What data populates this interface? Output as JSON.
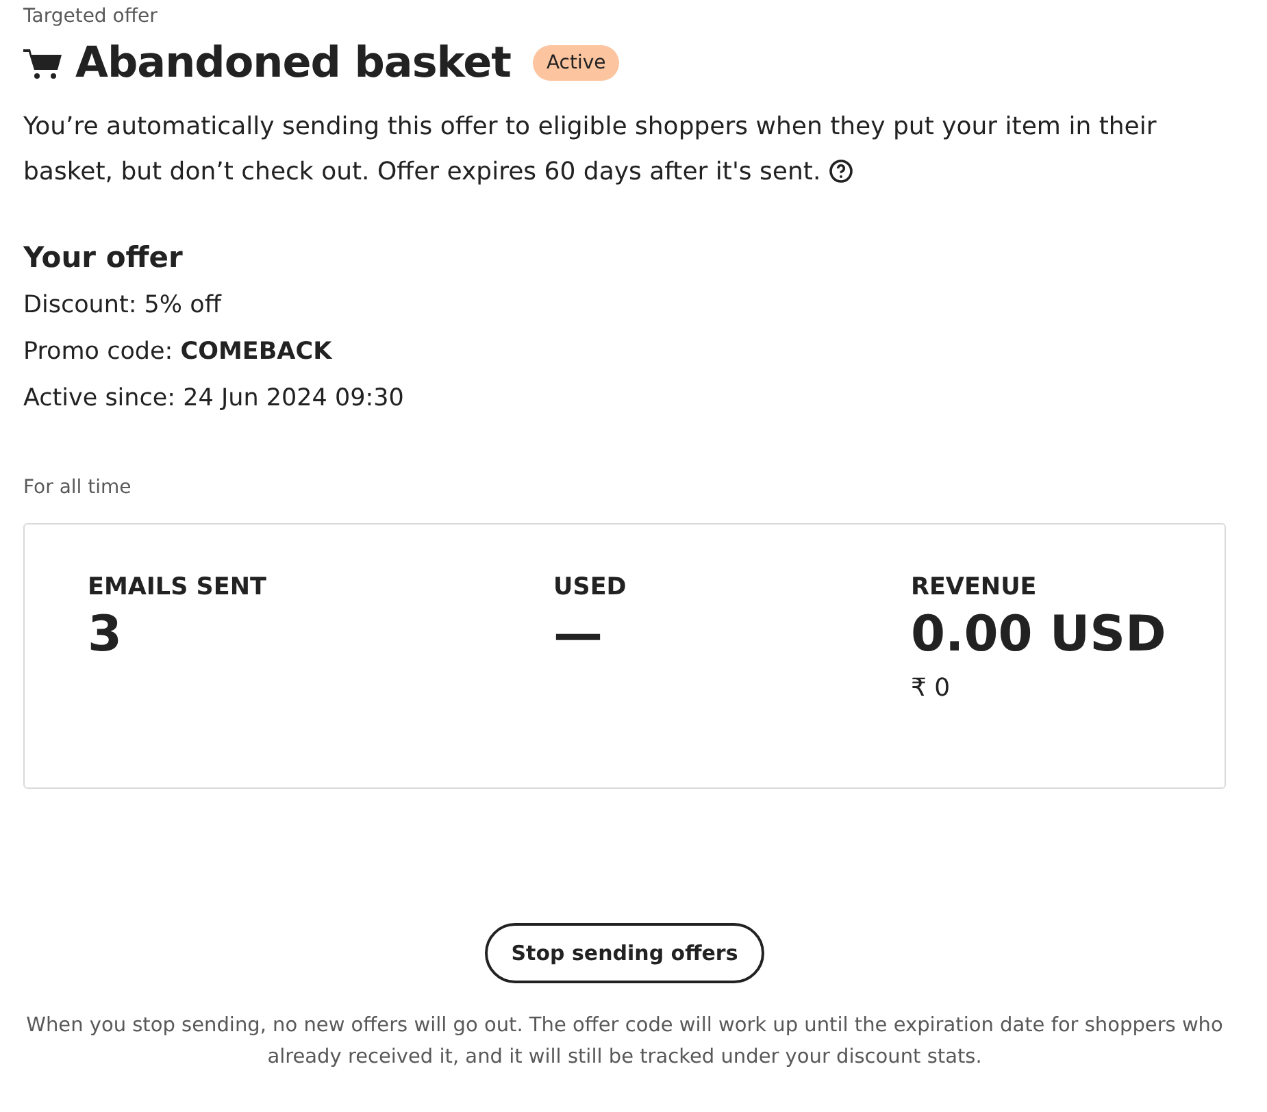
{
  "eyebrow": "Targeted offer",
  "title": "Abandoned basket",
  "status": {
    "label": "Active",
    "active": true
  },
  "description": "You’re automatically sending this offer to eligible shoppers when they put your item in their basket, but don’t check out. Offer expires 60 days after it's sent.",
  "offer": {
    "heading": "Your offer",
    "lines": [
      "Discount: 5% off",
      "Promo code: **COMEBACK**",
      "Active since: 24 Jun 2024 09:30"
    ]
  },
  "period": "For all time",
  "stats": [
    {
      "label": "EMAILS SENT",
      "value": "3"
    },
    {
      "label": "USED",
      "value": "—"
    },
    {
      "label": "REVENUE",
      "value": "0.00 USD",
      "sub": "₹ 0"
    }
  ],
  "button": "Stop sending offers",
  "footnote": "When you stop sending, no new offers will go out. The offer code will work up until the expiration date for shoppers who already received it, and it will still be tracked under your discount stats."
}
